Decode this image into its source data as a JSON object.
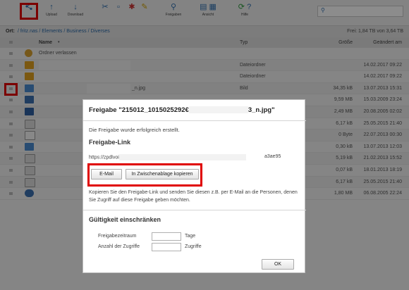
{
  "toolbar": {
    "upload": "Upload",
    "download": "Download",
    "freigaben": "Freigaben",
    "ansicht": "Ansicht",
    "hilfe": "Hilfe"
  },
  "breadcrumb": {
    "label": "Ort:",
    "path": "/ fritz.nas / Elements / Business / Diverses",
    "free_space": "Frei: 1,84 TB von 3,64 TB"
  },
  "table": {
    "headers": {
      "name": "Name",
      "type": "Typ",
      "size": "Größe",
      "modified": "Geändert am"
    },
    "parent_label": "Ordner verlassen",
    "rows": [
      {
        "name": "",
        "type": "Dateiordner",
        "size": "",
        "date": "14.02.2017 09:22"
      },
      {
        "name": "",
        "type": "Dateiordner",
        "size": "",
        "date": "14.02.2017 09:22"
      },
      {
        "name": "_n.jpg",
        "type": "Bild",
        "size": "34,35 kB",
        "date": "13.07.2013 15:31"
      },
      {
        "name": "",
        "type": "",
        "size": "9,59 MB",
        "date": "15.03.2009 23:24"
      },
      {
        "name": "",
        "type": "",
        "size": "2,49 MB",
        "date": "20.08.2005 02:02"
      },
      {
        "name": "",
        "type": "",
        "size": "6,17 kB",
        "date": "25.05.2015 21:40"
      },
      {
        "name": "",
        "type": "",
        "size": "0 Byte",
        "date": "22.07.2013 00:30"
      },
      {
        "name": "",
        "type": "",
        "size": "0,30 kB",
        "date": "13.07.2013 12:03"
      },
      {
        "name": "",
        "type": "",
        "size": "5,19 kB",
        "date": "21.02.2013 15:52"
      },
      {
        "name": "",
        "type": "",
        "size": "0,07 kB",
        "date": "18.01.2013 18:19"
      },
      {
        "name": "",
        "type": "",
        "size": "6,17 kB",
        "date": "25.05.2015 21:40"
      },
      {
        "name": "",
        "type": "",
        "size": "1,80 MB",
        "date": "06.08.2005 22:24"
      }
    ]
  },
  "dialog": {
    "title_start": "Freigabe \"215012_1015025292€",
    "title_end": "3_n.jpg\"",
    "success_msg": "Die Freigabe wurde erfolgreich erstellt.",
    "link_heading": "Freigabe-Link",
    "link_start": "https://zpdlvoi",
    "link_end": "a3ae95",
    "email_button": "E-Mail",
    "copy_button": "In Zwischenablage kopieren",
    "info_text": "Kopieren Sie den Freigabe-Link und senden Sie diesen z.B. per E-Mail an die Personen, denen Sie Zugriff auf diese Freigabe geben möchten.",
    "limit_heading": "Gültigkeit einschränken",
    "period_label": "Freigabezeitraum",
    "period_value": "",
    "period_unit": "Tage",
    "access_label": "Anzahl der Zugriffe",
    "access_value": "",
    "access_unit": "Zugriffe",
    "ok_button": "OK"
  },
  "colors": {
    "highlight": "#e00000",
    "link": "#2b6aa8",
    "folder": "#e0a020"
  }
}
